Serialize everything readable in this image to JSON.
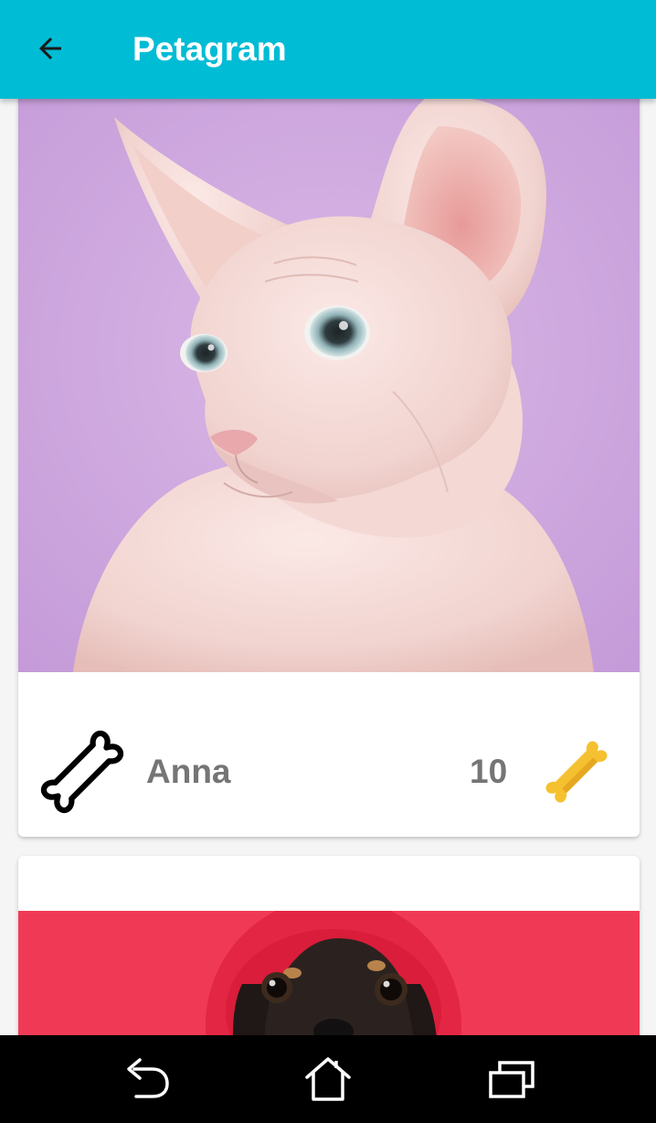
{
  "app_bar": {
    "title": "Petagram",
    "background_color": "#00bcd4",
    "back_icon": "arrow-back-icon"
  },
  "feed": [
    {
      "name": "Anna",
      "rating": "10",
      "photo": "hairless sphynx cat on lilac background",
      "rate_icon": "bone-outline-icon",
      "like_icon": "bone-filled-icon"
    },
    {
      "photo": "dachshund on red background"
    }
  ],
  "colors": {
    "app_bar": "#00bcd4",
    "text_secondary": "#757575",
    "bone_filled": "#f5c130",
    "nav_bar": "#000000"
  },
  "nav_bar": {
    "back_icon": "nav-back-icon",
    "home_icon": "nav-home-icon",
    "recents_icon": "nav-recents-icon"
  }
}
